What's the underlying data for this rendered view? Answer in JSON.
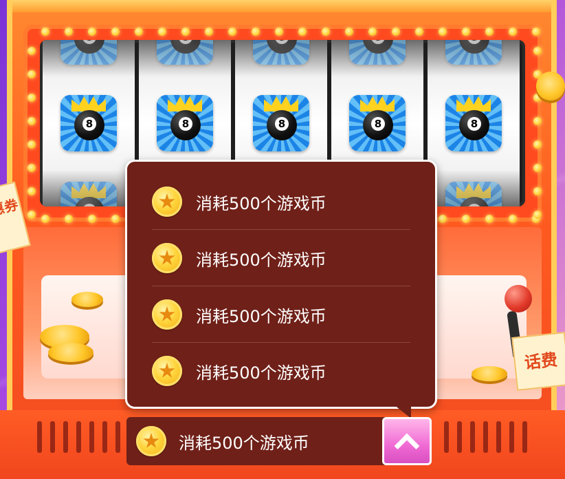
{
  "dropdown": {
    "options": [
      {
        "label": "消耗500个游戏币",
        "icon": "coin-icon"
      },
      {
        "label": "消耗500个游戏币",
        "icon": "coin-icon"
      },
      {
        "label": "消耗500个游戏币",
        "icon": "coin-icon"
      },
      {
        "label": "消耗500个游戏币",
        "icon": "coin-icon"
      }
    ]
  },
  "selector": {
    "selected_value": "消耗500个游戏币",
    "toggle_icon": "chevron-up-icon"
  },
  "machine": {
    "reel_symbol": "eight-ball-crown-icon",
    "reel_count": 5,
    "right_card_label": "话费",
    "left_card_label": "惠券"
  },
  "colors": {
    "accent_pink": "#f06ad4",
    "popup_bg": "#6f2018",
    "cabinet_orange": "#ff5b20",
    "coin_gold": "#ffd43a"
  }
}
